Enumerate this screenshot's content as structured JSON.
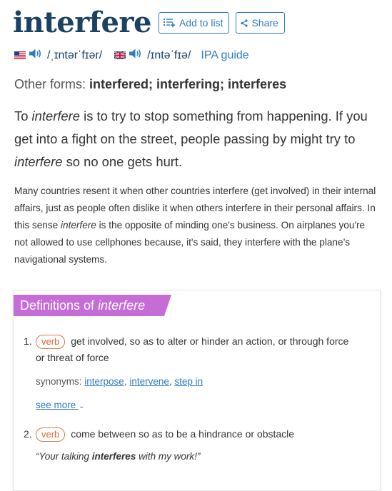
{
  "entry": {
    "word": "interfere",
    "add_to_list": "Add to list",
    "share": "Share"
  },
  "pronunciation": {
    "us_ipa": "/ˌɪntərˈfɪər/",
    "uk_ipa": "/ɪntəˈfɪə/",
    "ipa_guide": "IPA guide"
  },
  "other_forms": {
    "label": "Other forms: ",
    "value": "interfered; interfering; interferes"
  },
  "short_blurb": {
    "p1": "To ",
    "i1": "interfere",
    "p2": " is to try to stop something from happening. If you get into a fight on the street, people passing by might try to ",
    "i2": "interfere",
    "p3": " so no one gets hurt."
  },
  "long_blurb": {
    "p1": "Many countries resent it when other countries interfere (get involved) in their internal affairs, just as people often dislike it when others interfere in their personal affairs. In this sense ",
    "i1": "interfere",
    "p2": " is the opposite of minding one's business. On airplanes you're not allowed to use cellphones because, it's said, they interfere with the plane’s navigational systems."
  },
  "definitions": {
    "heading": "Definitions of ",
    "heading_word": "interfere",
    "senses": [
      {
        "number": "1.",
        "pos": "verb",
        "gloss": "get involved, so as to alter or hinder an action, or through force or threat of force",
        "synonyms_label": "synonyms: ",
        "synonyms": [
          "interpose",
          "intervene",
          "step in"
        ],
        "see_more": "see more"
      },
      {
        "number": "2.",
        "pos": "verb",
        "gloss": "come between so as to be a hindrance or obstacle",
        "example_pre": "“Your talking ",
        "example_word": "interferes",
        "example_post": " with my work!”"
      }
    ]
  },
  "colors": {
    "word": "#1b4164",
    "link": "#2f7bbf",
    "definitions_header": "#c56cd6",
    "pos_badge": "#d06a36"
  }
}
